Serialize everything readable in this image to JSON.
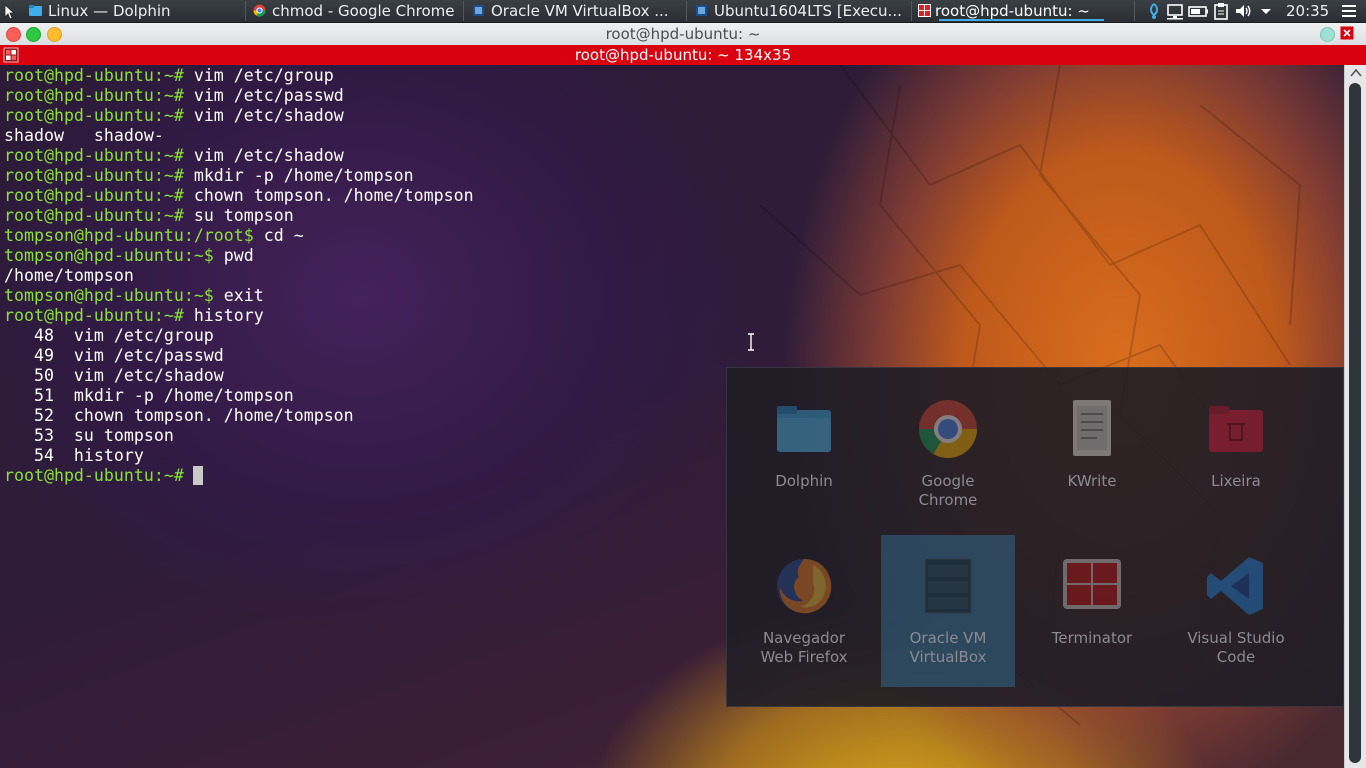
{
  "taskbar": {
    "tasks": [
      {
        "label": "Linux — Dolphin",
        "icon": "folder-icon"
      },
      {
        "label": "chmod - Google Chrome",
        "icon": "chrome-icon"
      },
      {
        "label": "Oracle VM VirtualBox ...",
        "icon": "virtualbox-icon"
      },
      {
        "label": "Ubuntu1604LTS [Execu...",
        "icon": "virtualbox-icon"
      },
      {
        "label": "root@hpd-ubuntu: ~",
        "icon": "terminator-icon",
        "active": true
      }
    ],
    "tray_icons": [
      "network-icon",
      "display-icon",
      "battery-icon",
      "clipboard-icon",
      "volume-icon",
      "expand-arrow-icon"
    ],
    "clock": "20:35"
  },
  "window": {
    "title": "root@hpd-ubuntu: ~",
    "buttons": [
      "close",
      "maximize",
      "minimize"
    ]
  },
  "terminal": {
    "header": "root@hpd-ubuntu: ~ 134x35",
    "lines": [
      {
        "prompt": "root@hpd-ubuntu:~# ",
        "cmd": "vim /etc/group"
      },
      {
        "prompt": "root@hpd-ubuntu:~# ",
        "cmd": "vim /etc/passwd"
      },
      {
        "prompt": "root@hpd-ubuntu:~# ",
        "cmd": "vim /etc/shadow"
      },
      {
        "out": "shadow   shadow-"
      },
      {
        "prompt": "root@hpd-ubuntu:~# ",
        "cmd": "vim /etc/shadow"
      },
      {
        "prompt": "root@hpd-ubuntu:~# ",
        "cmd": "mkdir -p /home/tompson"
      },
      {
        "prompt": "root@hpd-ubuntu:~# ",
        "cmd": "chown tompson. /home/tompson"
      },
      {
        "prompt": "root@hpd-ubuntu:~# ",
        "cmd": "su tompson"
      },
      {
        "prompt": "tompson@hpd-ubuntu:/root$ ",
        "cmd": "cd ~"
      },
      {
        "prompt": "tompson@hpd-ubuntu:~$ ",
        "cmd": "pwd"
      },
      {
        "out": "/home/tompson"
      },
      {
        "prompt": "tompson@hpd-ubuntu:~$ ",
        "cmd": "exit"
      },
      {
        "prompt": "root@hpd-ubuntu:~# ",
        "cmd": "history"
      },
      {
        "out": "   48  vim /etc/group"
      },
      {
        "out": "   49  vim /etc/passwd"
      },
      {
        "out": "   50  vim /etc/shadow"
      },
      {
        "out": "   51  mkdir -p /home/tompson"
      },
      {
        "out": "   52  chown tompson. /home/tompson"
      },
      {
        "out": "   53  su tompson"
      },
      {
        "out": "   54  history"
      },
      {
        "prompt": "root@hpd-ubuntu:~# ",
        "cmd": ""
      }
    ]
  },
  "launcher": {
    "apps": [
      {
        "label": "Dolphin",
        "icon": "folder-icon"
      },
      {
        "label": "Google Chrome",
        "icon": "chrome-icon"
      },
      {
        "label": "KWrite",
        "icon": "text-editor-icon"
      },
      {
        "label": "Lixeira",
        "icon": "trash-icon"
      },
      {
        "label": "Navegador Web Firefox",
        "icon": "firefox-icon"
      },
      {
        "label": "Oracle VM VirtualBox",
        "icon": "virtualbox-icon",
        "selected": true
      },
      {
        "label": "Terminator",
        "icon": "terminator-icon"
      },
      {
        "label": "Visual Studio Code",
        "icon": "vscode-icon"
      }
    ]
  },
  "colors": {
    "prompt": "#8ae234",
    "terminal_header": "#d9000f",
    "selection": "#3daee9"
  }
}
